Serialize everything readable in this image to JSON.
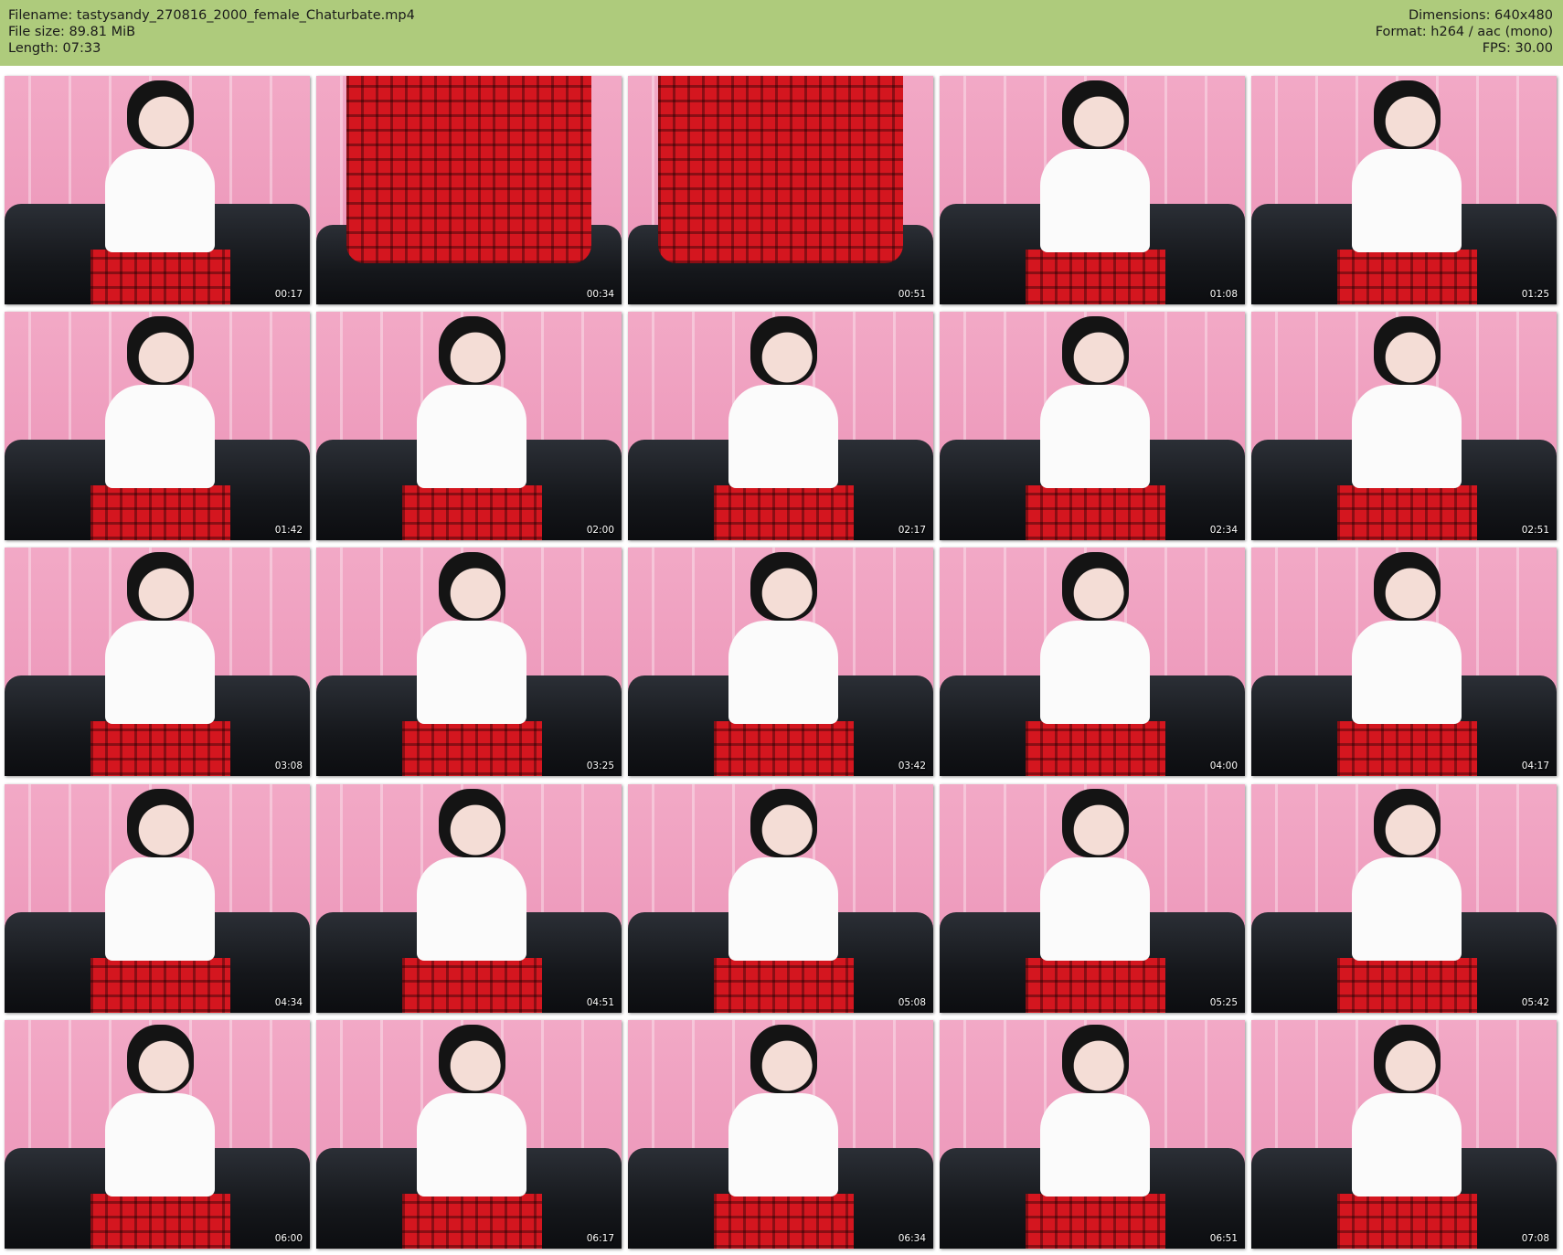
{
  "header": {
    "filename": "Filename: tastysandy_270816_2000_female_Chaturbate.mp4",
    "file_size": "File size: 89.81 MiB",
    "length": "Length: 07:33",
    "dimensions": "Dimensions: 640x480",
    "format": "Format: h264 / aac (mono)",
    "fps": "FPS: 30.00",
    "background_color": "#aecb7c"
  },
  "thumbnails": [
    {
      "timestamp": "00:17"
    },
    {
      "timestamp": "00:34"
    },
    {
      "timestamp": "00:51"
    },
    {
      "timestamp": "01:08"
    },
    {
      "timestamp": "01:25"
    },
    {
      "timestamp": "01:42"
    },
    {
      "timestamp": "02:00"
    },
    {
      "timestamp": "02:17"
    },
    {
      "timestamp": "02:34"
    },
    {
      "timestamp": "02:51"
    },
    {
      "timestamp": "03:08"
    },
    {
      "timestamp": "03:25"
    },
    {
      "timestamp": "03:42"
    },
    {
      "timestamp": "04:00"
    },
    {
      "timestamp": "04:17"
    },
    {
      "timestamp": "04:34"
    },
    {
      "timestamp": "04:51"
    },
    {
      "timestamp": "05:08"
    },
    {
      "timestamp": "05:25"
    },
    {
      "timestamp": "05:42"
    },
    {
      "timestamp": "06:00"
    },
    {
      "timestamp": "06:17"
    },
    {
      "timestamp": "06:34"
    },
    {
      "timestamp": "06:51"
    },
    {
      "timestamp": "07:08"
    }
  ]
}
